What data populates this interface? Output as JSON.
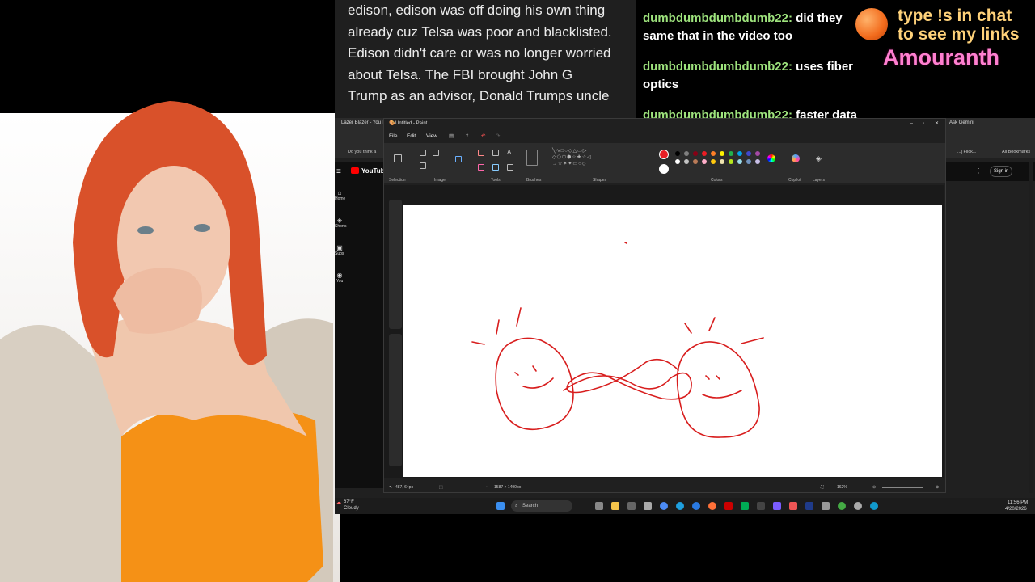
{
  "article": {
    "lines": [
      "edison, edison was off doing his own thing",
      "already cuz Telsa was poor and blacklisted.",
      "Edison didn't care or was no longer worried",
      "about Telsa. The FBI brought John G",
      "Trump as an advisor, Donald Trumps uncle"
    ]
  },
  "chat": {
    "messages": [
      {
        "user": "dumbdumbdumbdumb22:",
        "text": " did they same that in the video too"
      },
      {
        "user": "dumbdumbdumbdumb22:",
        "text": " uses fiber optics"
      },
      {
        "user": "dumbdumbdumbdumb22:",
        "text": " faster data"
      }
    ]
  },
  "promo": {
    "line1": "type !s in chat",
    "line2": "to see my links",
    "brand": "Amouranth"
  },
  "browser": {
    "tab1": "Lazer Blazer - YouTub",
    "bookmark1": "Do you think a",
    "bookmark_right": "All Bookmarks",
    "bookmark_mid": "...| Flick...",
    "ask": "Ask Gemini",
    "yt_logo": "YouTube",
    "sign_in": "Sign in",
    "side_items": [
      "Home",
      "Shorts",
      "Subscriptions",
      "You"
    ]
  },
  "paint": {
    "title": "Untitled - Paint",
    "menu": [
      "File",
      "Edit",
      "View"
    ],
    "groups": {
      "selection": "Selection",
      "image": "Image",
      "tools": "Tools",
      "brushes": "Brushes",
      "shapes": "Shapes",
      "colors": "Colors",
      "copilot": "Copilot",
      "layers": "Layers"
    },
    "status_cursor": "487, 64px",
    "status_size": "1587 × 1490px",
    "zoom": "162%",
    "palette": [
      "#000000",
      "#7f7f7f",
      "#880015",
      "#ed1c24",
      "#ff7f27",
      "#fff200",
      "#22b14c",
      "#00a2e8",
      "#3f48cc",
      "#a349a4",
      "#ffffff",
      "#c3c3c3",
      "#b97a57",
      "#ffaec9",
      "#ffc90e",
      "#efe4b0",
      "#b5e61d",
      "#99d9ea",
      "#7092be",
      "#c8bfe7"
    ],
    "active_color": "#e81e25"
  },
  "taskbar": {
    "weather_temp": "67°F",
    "weather_desc": "Cloudy",
    "search": "Search",
    "time": "11:56 PM",
    "date": "4/20/2026"
  }
}
